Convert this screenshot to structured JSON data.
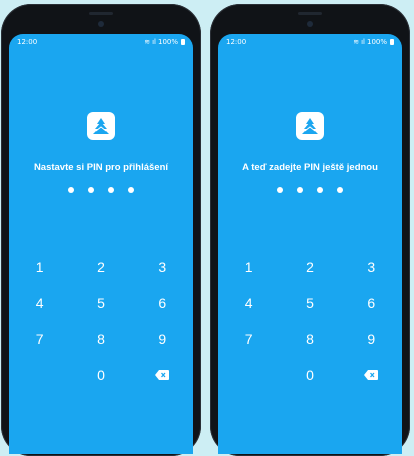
{
  "colors": {
    "page_bg": "#cdeef4",
    "screen": "#1aa6f0",
    "text": "#ffffff"
  },
  "status_bar": {
    "time": "12:00",
    "battery": "100%"
  },
  "left_screen": {
    "prompt": "Nastavte si PIN pro přihlášení",
    "pin_dots_count": 4
  },
  "right_screen": {
    "prompt": "A teď zadejte PIN ještě jednou",
    "pin_dots_count": 4
  },
  "keypad": {
    "keys": [
      "1",
      "2",
      "3",
      "4",
      "5",
      "6",
      "7",
      "8",
      "9",
      "",
      "0",
      "backspace"
    ]
  },
  "icons": {
    "app_logo": "tree-logo-icon",
    "delete": "backspace-icon",
    "signal": "signal-icon",
    "wifi": "wifi-icon",
    "battery": "battery-icon"
  }
}
